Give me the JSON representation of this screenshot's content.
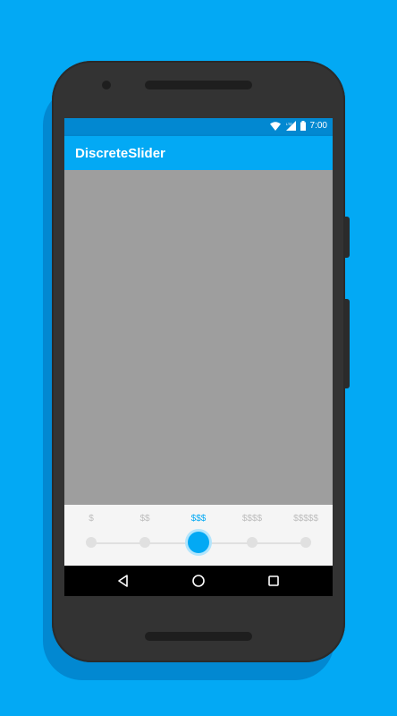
{
  "status_bar": {
    "time": "7:00",
    "icons": [
      "wifi-icon",
      "lte-signal-icon",
      "battery-icon"
    ],
    "background_color": "#0288D1"
  },
  "app_bar": {
    "title": "DiscreteSlider",
    "background_color": "#03A9F4"
  },
  "slider": {
    "labels": [
      "$",
      "$$",
      "$$$",
      "$$$$",
      "$$$$$"
    ],
    "selected_index": 2,
    "accent_color": "#03A9F4",
    "inactive_color": "#E0E0E0"
  },
  "nav_bar": {
    "buttons": [
      "back-icon",
      "home-icon",
      "recents-icon"
    ]
  },
  "colors": {
    "background": "#03A9F4",
    "content_area": "#9E9E9E",
    "phone_body": "#333333"
  }
}
